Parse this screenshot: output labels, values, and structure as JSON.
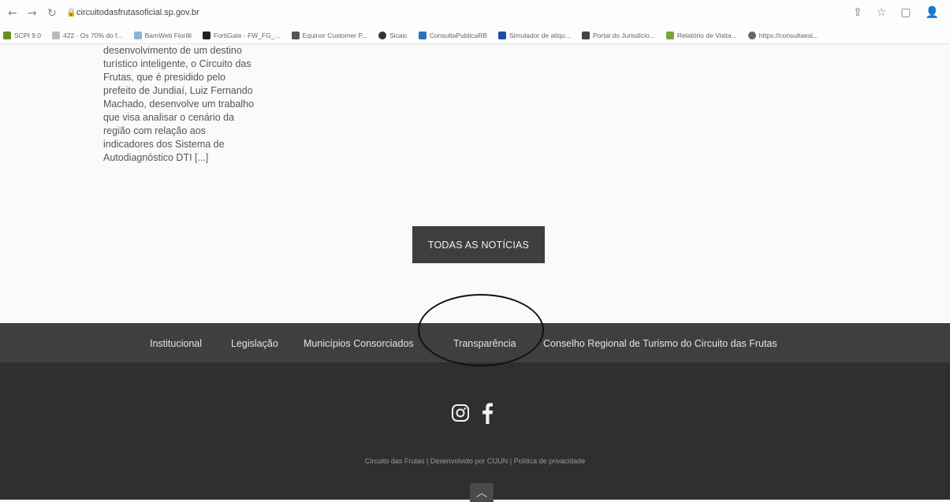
{
  "browser": {
    "url": "circuitodasfrutasoficial.sp.gov.br",
    "bookmarks": [
      {
        "label": "SCPI 9.0",
        "color": "#6b8e23"
      },
      {
        "label": "422 - Os 70% do f...",
        "color": "#bbbbbb"
      },
      {
        "label": "BamWeb Fiorilli",
        "color": "#8ab4d8"
      },
      {
        "label": "FortiGate - FW_FG_...",
        "color": "#222222"
      },
      {
        "label": "Equinor Customer P...",
        "color": "#555555"
      },
      {
        "label": "Sicaic",
        "color": "#333333"
      },
      {
        "label": "ConsultaPublicaRB",
        "color": "#2e6fb7"
      },
      {
        "label": "Simulador de alíqu...",
        "color": "#1e4fa0"
      },
      {
        "label": "Portal do Jurisdicio...",
        "color": "#444444"
      },
      {
        "label": "Relatório de Visita...",
        "color": "#7aa33a"
      },
      {
        "label": "https://consultaesi...",
        "color": "#666666"
      }
    ]
  },
  "article": {
    "lines": [
      "desenvolvimento de um destino",
      "turístico inteligente, o Circuito das",
      "Frutas, que é presidido pelo",
      "prefeito de Jundiaí, Luiz Fernando",
      "Machado, desenvolve um trabalho",
      "que visa analisar o cenário da",
      "região com relação aos",
      "indicadores dos Sistema de",
      "Autodiagnóstico DTI [...]"
    ]
  },
  "news_button": {
    "label": "TODAS AS NOTÍCIAS"
  },
  "footer_nav": {
    "items": [
      "Institucional",
      "Legislação",
      "Municípios Consorciados",
      "Transparência",
      "Conselho Regional de Turismo do Circuito das Frutas"
    ]
  },
  "credits": "Circuito das Frutas | Desenvolvido por CIJUN | Política de privacidade",
  "colors": {
    "footer_nav_bg": "#3f3f3f",
    "footer_bg": "#2f2f2f",
    "button_bg": "#3e3e3e"
  }
}
